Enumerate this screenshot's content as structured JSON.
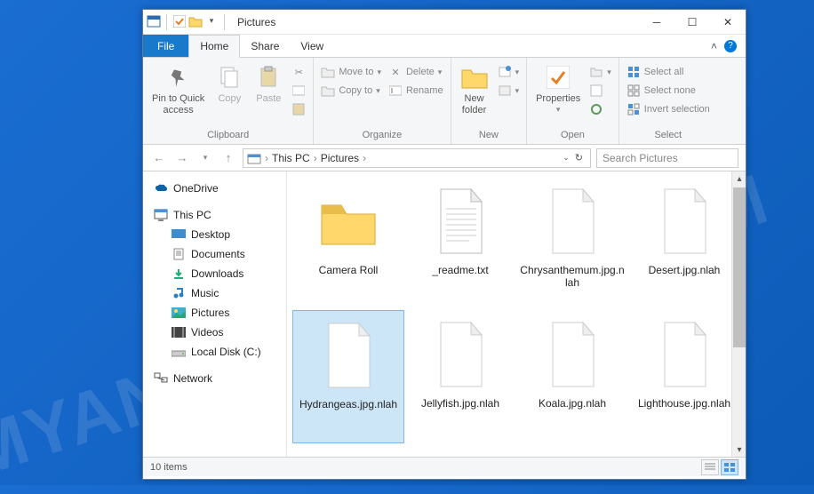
{
  "window": {
    "title": "Pictures",
    "tabs": {
      "file": "File",
      "home": "Home",
      "share": "Share",
      "view": "View"
    }
  },
  "ribbon": {
    "clipboard": {
      "label": "Clipboard",
      "pin": "Pin to Quick\naccess",
      "copy": "Copy",
      "paste": "Paste"
    },
    "organize": {
      "label": "Organize",
      "moveto": "Move to",
      "copyto": "Copy to",
      "delete": "Delete",
      "rename": "Rename"
    },
    "new": {
      "label": "New",
      "newfolder": "New\nfolder"
    },
    "open": {
      "label": "Open",
      "properties": "Properties"
    },
    "select": {
      "label": "Select",
      "all": "Select all",
      "none": "Select none",
      "invert": "Invert selection"
    }
  },
  "address": {
    "crumbs": [
      "This PC",
      "Pictures"
    ],
    "search_placeholder": "Search Pictures"
  },
  "sidebar": {
    "onedrive": "OneDrive",
    "thispc": "This PC",
    "desktop": "Desktop",
    "documents": "Documents",
    "downloads": "Downloads",
    "music": "Music",
    "pictures": "Pictures",
    "videos": "Videos",
    "localdisk": "Local Disk (C:)",
    "network": "Network"
  },
  "files": [
    {
      "name": "Camera Roll",
      "type": "folder"
    },
    {
      "name": "_readme.txt",
      "type": "txt"
    },
    {
      "name": "Chrysanthemum.jpg.nlah",
      "type": "blank"
    },
    {
      "name": "Desert.jpg.nlah",
      "type": "blank"
    },
    {
      "name": "Hydrangeas.jpg.nlah",
      "type": "blank",
      "selected": true
    },
    {
      "name": "Jellyfish.jpg.nlah",
      "type": "blank"
    },
    {
      "name": "Koala.jpg.nlah",
      "type": "blank"
    },
    {
      "name": "Lighthouse.jpg.nlah",
      "type": "blank"
    }
  ],
  "status": {
    "count": "10 items"
  },
  "watermark": "MYANTISPYWARE.COM"
}
